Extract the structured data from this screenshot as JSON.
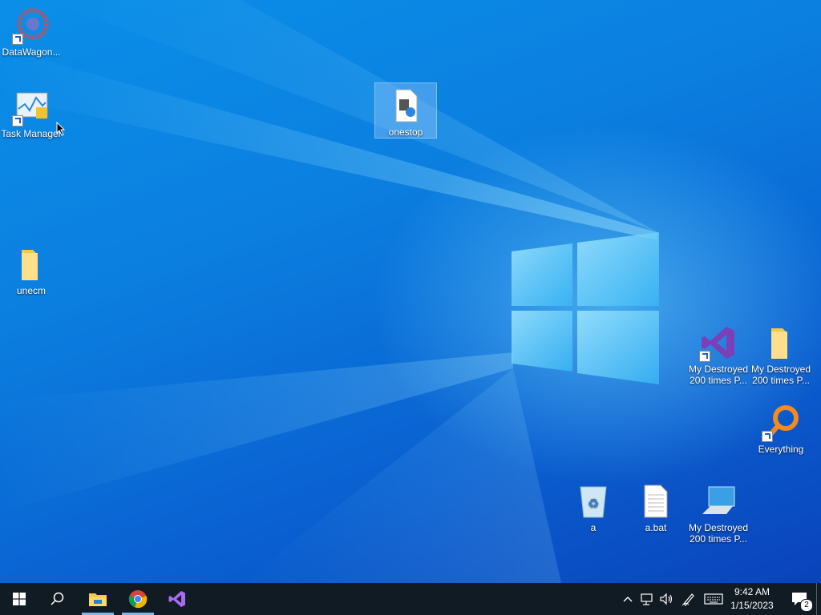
{
  "desktop": {
    "icons": [
      {
        "name": "DataWagon...",
        "icon": "gear-app-icon"
      },
      {
        "name": "Task Manager",
        "icon": "task-manager-icon"
      },
      {
        "name": "onestop",
        "icon": "media-file-icon"
      },
      {
        "name": "unecm",
        "icon": "folder-icon"
      },
      {
        "name": "My Destroyed 200 times P...",
        "icon": "visual-studio-icon"
      },
      {
        "name": "My Destroyed 200 times P...",
        "icon": "folder-icon"
      },
      {
        "name": "Everything",
        "icon": "everything-search-icon"
      },
      {
        "name": "a",
        "icon": "recycle-bin-icon"
      },
      {
        "name": "a.bat",
        "icon": "text-file-icon"
      },
      {
        "name": "My Destroyed 200 times P...",
        "icon": "computer-icon"
      }
    ]
  },
  "taskbar": {
    "pinned": [
      "start-icon",
      "search-icon",
      "file-explorer-icon",
      "chrome-icon",
      "visual-studio-icon"
    ],
    "tray": [
      "chevron-up-icon",
      "network-icon",
      "volume-icon",
      "pen-icon",
      "keyboard-icon"
    ],
    "clock": {
      "time": "9:42 AM",
      "date": "1/15/2023"
    },
    "notifications": {
      "count": "2"
    }
  },
  "colors": {
    "taskbar": "#101b24",
    "accent": "#0a7fe0"
  }
}
